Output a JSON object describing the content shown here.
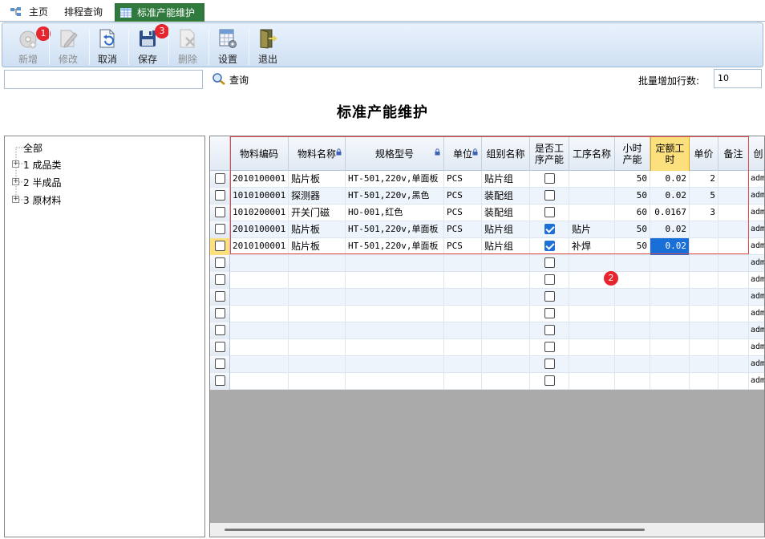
{
  "tabs": [
    {
      "label": "主页",
      "icon": "home-tree-icon"
    },
    {
      "label": "排程查询",
      "icon": ""
    },
    {
      "label": "标准产能维护",
      "icon": "table-icon",
      "active": true
    }
  ],
  "toolbar": {
    "buttons": [
      {
        "label": "新增",
        "icon": "add-disk-icon",
        "disabled": true,
        "badge": "1"
      },
      {
        "label": "修改",
        "icon": "edit-pencil-icon",
        "disabled": true
      },
      {
        "label": "取消",
        "icon": "undo-doc-icon",
        "disabled": false
      },
      {
        "label": "保存",
        "icon": "save-floppy-icon",
        "disabled": false,
        "badge": "3"
      },
      {
        "label": "删除",
        "icon": "delete-doc-icon",
        "disabled": true
      },
      {
        "label": "设置",
        "icon": "settings-sheet-icon",
        "disabled": false
      },
      {
        "label": "退出",
        "icon": "exit-door-icon",
        "disabled": false
      }
    ]
  },
  "query": {
    "search_value": "",
    "button_label": "查询",
    "batch_label": "批量增加行数:",
    "batch_value": "10"
  },
  "page_title": "标准产能维护",
  "tree": {
    "root": "全部",
    "children": [
      "1 成品类",
      "2 半成品",
      "3 原材料"
    ]
  },
  "grid": {
    "columns": [
      "物料编码",
      "物料名称",
      "规格型号",
      "单位",
      "组别名称",
      "是否工序产能",
      "工序名称",
      "小时产能",
      "定额工时",
      "单价",
      "备注",
      "创"
    ],
    "header_lines": {
      "col5": [
        "是否工",
        "序产能"
      ],
      "col7": [
        "小时",
        "产能"
      ],
      "col8": [
        "定额工",
        "时"
      ]
    },
    "rows": [
      {
        "code": "2010100001",
        "name": "贴片板",
        "spec": "HT-501,220v,单面板",
        "unit": "PCS",
        "group": "贴片组",
        "is_proc": false,
        "proc": "",
        "hourly": "50",
        "std_time": "0.02",
        "price": "2",
        "remark": "",
        "creator": "adm"
      },
      {
        "code": "1010100001",
        "name": "探测器",
        "spec": "HT-501,220v,黑色",
        "unit": "PCS",
        "group": "装配组",
        "is_proc": false,
        "proc": "",
        "hourly": "50",
        "std_time": "0.02",
        "price": "5",
        "remark": "",
        "creator": "adm"
      },
      {
        "code": "1010200001",
        "name": "开关门磁",
        "spec": "HO-001,红色",
        "unit": "PCS",
        "group": "装配组",
        "is_proc": false,
        "proc": "",
        "hourly": "60",
        "std_time": "0.0167",
        "price": "3",
        "remark": "",
        "creator": "adm"
      },
      {
        "code": "2010100001",
        "name": "贴片板",
        "spec": "HT-501,220v,单面板",
        "unit": "PCS",
        "group": "贴片组",
        "is_proc": true,
        "proc": "贴片",
        "hourly": "50",
        "std_time": "0.02",
        "price": "",
        "remark": "",
        "creator": "adm"
      },
      {
        "code": "2010100001",
        "name": "贴片板",
        "spec": "HT-501,220v,单面板",
        "unit": "PCS",
        "group": "贴片组",
        "is_proc": true,
        "proc": "补焊",
        "hourly": "50",
        "std_time": "0.02",
        "price": "",
        "remark": "",
        "creator": "adm"
      }
    ],
    "empty_rows": 8,
    "empty_creator": "adm",
    "annotation_badge": "2"
  }
}
